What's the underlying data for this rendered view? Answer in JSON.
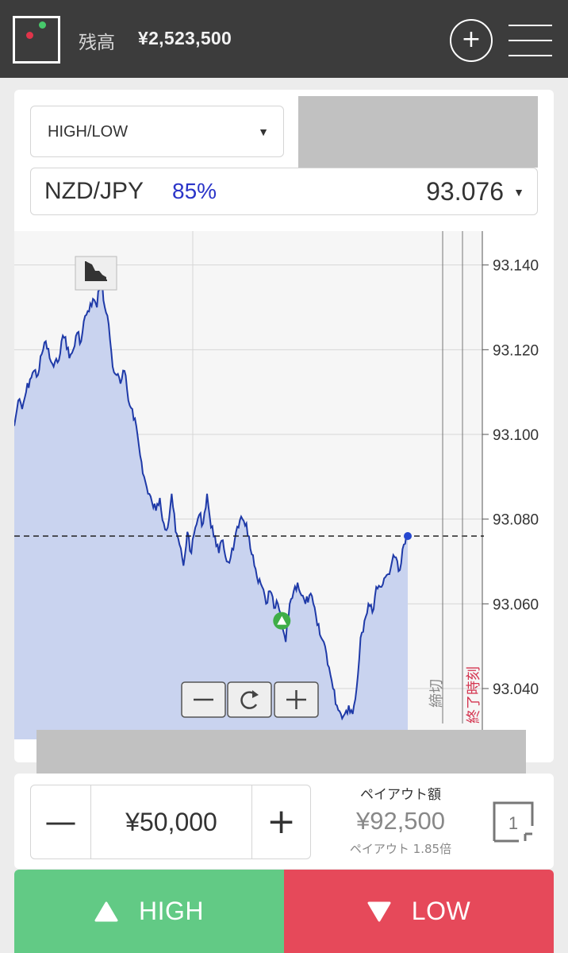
{
  "header": {
    "balance_label": "残高",
    "balance_value": "¥2,523,500",
    "add_icon": "plus-icon",
    "menu_icon": "hamburger-icon"
  },
  "trade": {
    "option_type": "HIGH/LOW",
    "pair": "NZD/JPY",
    "payout_rate": "85%",
    "current_rate": "93.076"
  },
  "chart_data": {
    "type": "area",
    "ylim": [
      93.028,
      93.148
    ],
    "y_ticks": [
      93.14,
      93.12,
      93.1,
      93.08,
      93.06,
      93.04
    ],
    "y_tick_labels": [
      "93.140",
      "93.120",
      "93.100",
      "93.080",
      "93.060",
      "93.040"
    ],
    "current_value": 93.076,
    "entry_marker": {
      "t": 0.68,
      "y": 93.056
    },
    "vertical_markers": [
      "締切",
      "終了時刻"
    ],
    "series": [
      {
        "t": [
          0,
          0.01,
          0.02,
          0.03,
          0.04,
          0.05,
          0.06,
          0.07,
          0.08,
          0.09,
          0.1,
          0.11,
          0.12,
          0.13,
          0.14,
          0.15,
          0.16,
          0.17,
          0.18,
          0.19,
          0.2,
          0.21,
          0.22,
          0.23,
          0.24,
          0.25,
          0.26,
          0.27,
          0.28,
          0.29,
          0.3,
          0.31,
          0.32,
          0.33,
          0.34,
          0.35,
          0.36,
          0.37,
          0.38,
          0.39,
          0.4,
          0.41,
          0.42,
          0.43,
          0.44,
          0.45,
          0.46,
          0.47,
          0.48,
          0.49,
          0.5,
          0.51,
          0.52,
          0.53,
          0.54,
          0.55,
          0.56,
          0.57,
          0.58,
          0.59,
          0.6,
          0.61,
          0.62,
          0.63,
          0.64,
          0.65,
          0.66,
          0.67,
          0.68,
          0.69,
          0.7,
          0.71,
          0.72,
          0.73,
          0.74,
          0.75,
          0.76,
          0.77,
          0.78,
          0.79,
          0.8,
          0.81,
          0.82,
          0.83,
          0.84,
          0.85,
          0.86,
          0.87,
          0.88,
          0.89,
          0.9,
          0.91,
          0.92,
          0.93,
          0.94,
          0.95,
          0.96,
          0.97,
          0.98,
          0.99
        ],
        "y": [
          93.102,
          93.108,
          93.106,
          93.11,
          93.113,
          93.115,
          93.114,
          93.119,
          93.122,
          93.118,
          93.116,
          93.117,
          93.122,
          93.123,
          93.118,
          93.12,
          93.124,
          93.122,
          93.128,
          93.129,
          93.132,
          93.13,
          93.138,
          93.13,
          93.126,
          93.116,
          93.114,
          93.112,
          93.115,
          93.108,
          93.106,
          93.102,
          93.095,
          93.09,
          93.086,
          93.084,
          93.082,
          93.085,
          93.079,
          93.078,
          93.086,
          93.077,
          93.074,
          93.069,
          93.077,
          93.072,
          93.078,
          93.081,
          93.079,
          93.086,
          93.078,
          93.076,
          93.072,
          93.075,
          93.07,
          93.071,
          93.075,
          93.078,
          93.08,
          93.079,
          93.073,
          93.069,
          93.065,
          93.064,
          93.06,
          93.063,
          93.059,
          93.06,
          93.055,
          93.051,
          93.06,
          93.063,
          93.065,
          93.062,
          93.06,
          93.062,
          93.06,
          93.055,
          93.052,
          93.05,
          93.045,
          93.04,
          93.036,
          93.034,
          93.034,
          93.036,
          93.034,
          93.04,
          93.052,
          93.056,
          93.06,
          93.058,
          93.064,
          93.064,
          93.066,
          93.067,
          93.07,
          93.071,
          93.068,
          93.074
        ]
      }
    ]
  },
  "chart_controls": {
    "zoom_out_icon": "minus-icon",
    "reset_icon": "refresh-icon",
    "zoom_in_icon": "plus-icon",
    "chart_type_icon": "area-chart-icon"
  },
  "panel": {
    "minus_label": "—",
    "amount": "¥50,000",
    "plus_label": "+",
    "payout_title": "ペイアウト額",
    "payout_value": "¥92,500",
    "payout_multiplier": "ペイアウト 1.85倍",
    "multi_count": "1"
  },
  "actions": {
    "high_label": "HIGH",
    "low_label": "LOW"
  },
  "colors": {
    "header_bg": "#3c3c3c",
    "accent_blue": "#2a34c8",
    "line": "#1f3aa8",
    "area": "#c9d3ef",
    "high": "#62ca85",
    "low": "#e6495a",
    "deadline_label": "#888888",
    "expiry_label": "#d4344f"
  }
}
